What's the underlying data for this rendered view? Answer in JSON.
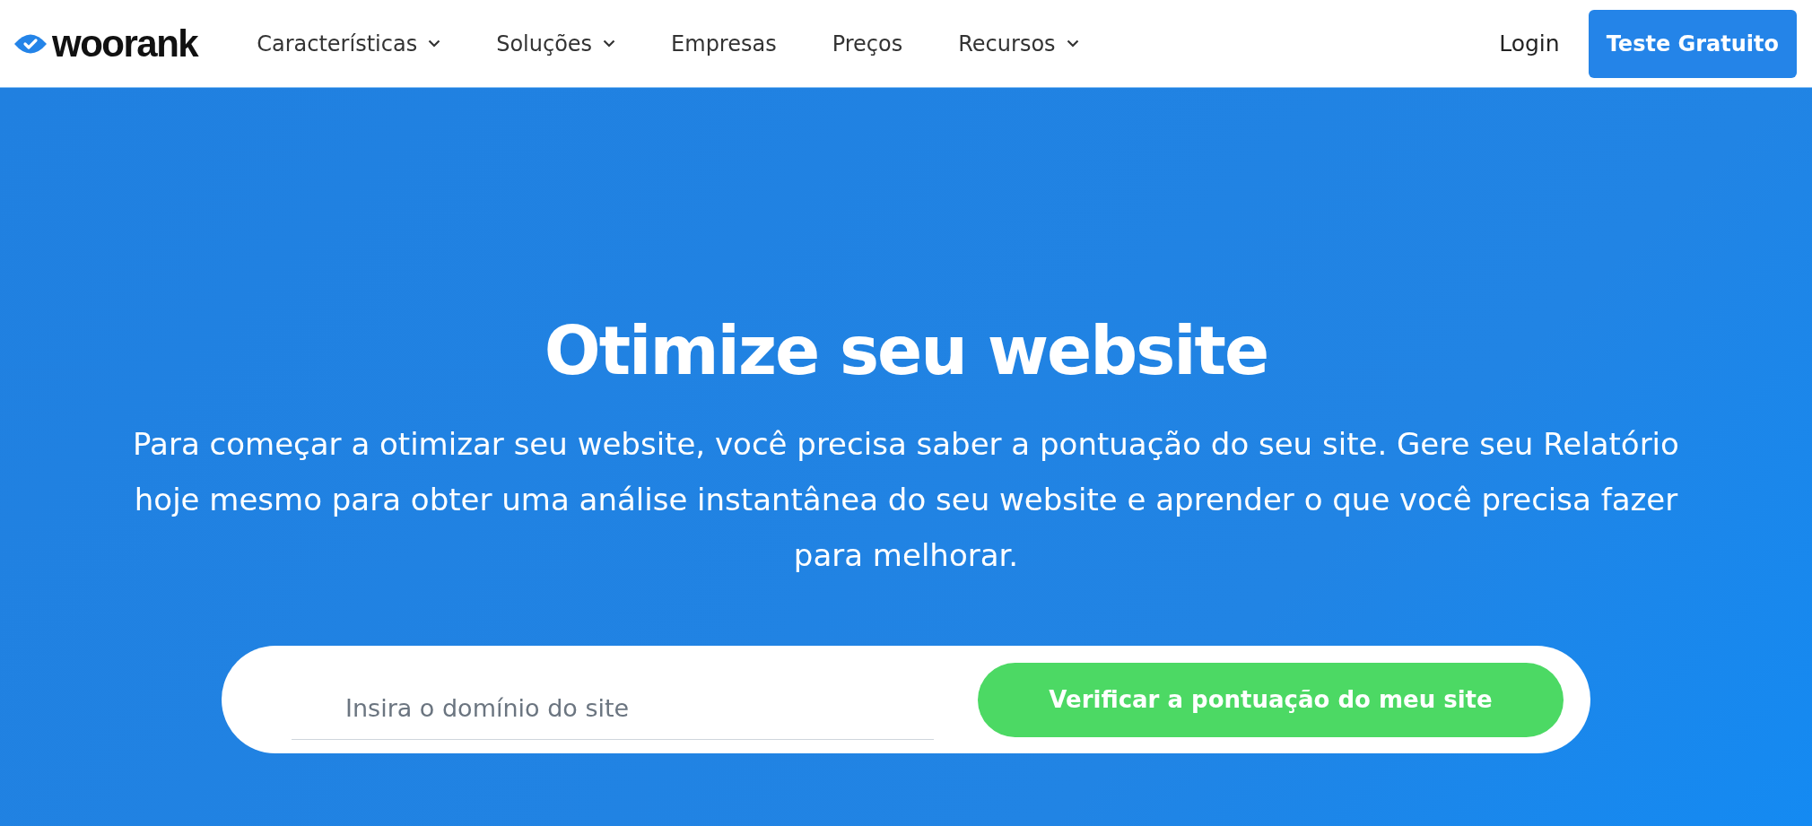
{
  "header": {
    "logo": "woorank",
    "nav": [
      {
        "label": "Características",
        "dropdown": true
      },
      {
        "label": "Soluções",
        "dropdown": true
      },
      {
        "label": "Empresas",
        "dropdown": false
      },
      {
        "label": "Preços",
        "dropdown": false
      },
      {
        "label": "Recursos",
        "dropdown": true
      }
    ],
    "login": "Login",
    "cta": "Teste Gratuito"
  },
  "hero": {
    "title": "Otimize seu website",
    "text": "Para começar a otimizar seu website, você precisa saber a pontuação do seu site. Gere seu Relatório hoje mesmo para obter uma análise instantânea do seu website e aprender o que você precisa fazer para melhorar.",
    "search": {
      "placeholder": "Insira o domínio do site",
      "button": "Verificar a pontuação do meu site"
    }
  }
}
